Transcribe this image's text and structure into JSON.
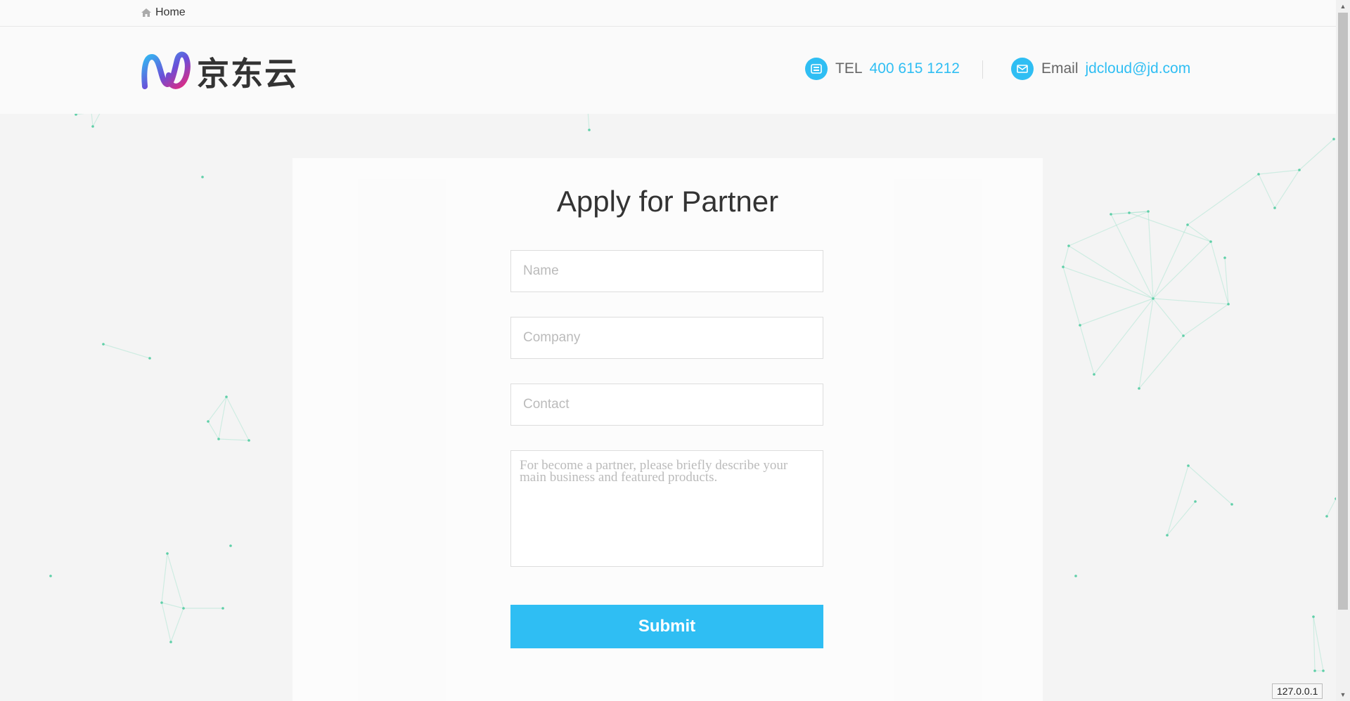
{
  "breadcrumb": {
    "home_label": "Home",
    "icon": "home-icon"
  },
  "header": {
    "logo_text": "京东云",
    "tel_label": "TEL",
    "tel_value": "400 615 1212",
    "email_label": "Email",
    "email_value": "jdcloud@jd.com",
    "accent_color": "#2fbef3"
  },
  "form": {
    "title": "Apply for Partner",
    "name_placeholder": "Name",
    "company_placeholder": "Company",
    "contact_placeholder": "Contact",
    "description_placeholder": "For become a partner, please briefly describe your main business and featured products.",
    "submit_label": "Submit"
  },
  "status": {
    "host": "127.0.0.1"
  }
}
